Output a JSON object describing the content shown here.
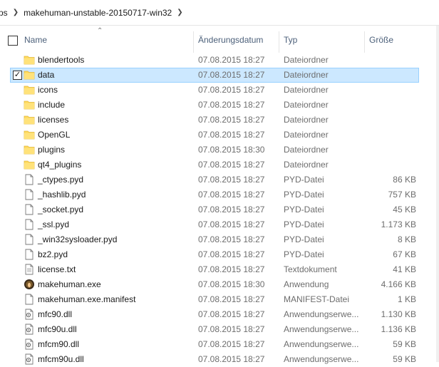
{
  "breadcrumb": {
    "prev": "ps",
    "current": "makehuman-unstable-20150717-win32"
  },
  "columns": {
    "name": "Name",
    "date": "Änderungsdatum",
    "type": "Typ",
    "size": "Größe"
  },
  "files": [
    {
      "name": "blendertools",
      "date": "07.08.2015 18:27",
      "type": "Dateiordner",
      "size": "",
      "icon": "folder-icon"
    },
    {
      "name": "data",
      "date": "07.08.2015 18:27",
      "type": "Dateiordner",
      "size": "",
      "icon": "folder-icon",
      "selected": true
    },
    {
      "name": "icons",
      "date": "07.08.2015 18:27",
      "type": "Dateiordner",
      "size": "",
      "icon": "folder-icon"
    },
    {
      "name": "include",
      "date": "07.08.2015 18:27",
      "type": "Dateiordner",
      "size": "",
      "icon": "folder-icon"
    },
    {
      "name": "licenses",
      "date": "07.08.2015 18:27",
      "type": "Dateiordner",
      "size": "",
      "icon": "folder-icon"
    },
    {
      "name": "OpenGL",
      "date": "07.08.2015 18:27",
      "type": "Dateiordner",
      "size": "",
      "icon": "folder-icon"
    },
    {
      "name": "plugins",
      "date": "07.08.2015 18:30",
      "type": "Dateiordner",
      "size": "",
      "icon": "folder-icon"
    },
    {
      "name": "qt4_plugins",
      "date": "07.08.2015 18:27",
      "type": "Dateiordner",
      "size": "",
      "icon": "folder-icon"
    },
    {
      "name": "_ctypes.pyd",
      "date": "07.08.2015 18:27",
      "type": "PYD-Datei",
      "size": "86 KB",
      "icon": "file-icon"
    },
    {
      "name": "_hashlib.pyd",
      "date": "07.08.2015 18:27",
      "type": "PYD-Datei",
      "size": "757 KB",
      "icon": "file-icon"
    },
    {
      "name": "_socket.pyd",
      "date": "07.08.2015 18:27",
      "type": "PYD-Datei",
      "size": "45 KB",
      "icon": "file-icon"
    },
    {
      "name": "_ssl.pyd",
      "date": "07.08.2015 18:27",
      "type": "PYD-Datei",
      "size": "1.173 KB",
      "icon": "file-icon"
    },
    {
      "name": "_win32sysloader.pyd",
      "date": "07.08.2015 18:27",
      "type": "PYD-Datei",
      "size": "8 KB",
      "icon": "file-icon"
    },
    {
      "name": "bz2.pyd",
      "date": "07.08.2015 18:27",
      "type": "PYD-Datei",
      "size": "67 KB",
      "icon": "file-icon"
    },
    {
      "name": "license.txt",
      "date": "07.08.2015 18:27",
      "type": "Textdokument",
      "size": "41 KB",
      "icon": "text-file-icon"
    },
    {
      "name": "makehuman.exe",
      "date": "07.08.2015 18:30",
      "type": "Anwendung",
      "size": "4.166 KB",
      "icon": "makehuman-app-icon"
    },
    {
      "name": "makehuman.exe.manifest",
      "date": "07.08.2015 18:27",
      "type": "MANIFEST-Datei",
      "size": "1 KB",
      "icon": "file-icon"
    },
    {
      "name": "mfc90.dll",
      "date": "07.08.2015 18:27",
      "type": "Anwendungserwe...",
      "size": "1.130 KB",
      "icon": "dll-file-icon"
    },
    {
      "name": "mfc90u.dll",
      "date": "07.08.2015 18:27",
      "type": "Anwendungserwe...",
      "size": "1.136 KB",
      "icon": "dll-file-icon"
    },
    {
      "name": "mfcm90.dll",
      "date": "07.08.2015 18:27",
      "type": "Anwendungserwe...",
      "size": "59 KB",
      "icon": "dll-file-icon"
    },
    {
      "name": "mfcm90u.dll",
      "date": "07.08.2015 18:27",
      "type": "Anwendungserwe...",
      "size": "59 KB",
      "icon": "dll-file-icon"
    }
  ],
  "colors": {
    "folder": "#ffd95c",
    "selection_bg": "#cce8ff",
    "selection_border": "#99d1ff",
    "header_text": "#4c607a",
    "secondary_text": "#6d6d6d"
  }
}
